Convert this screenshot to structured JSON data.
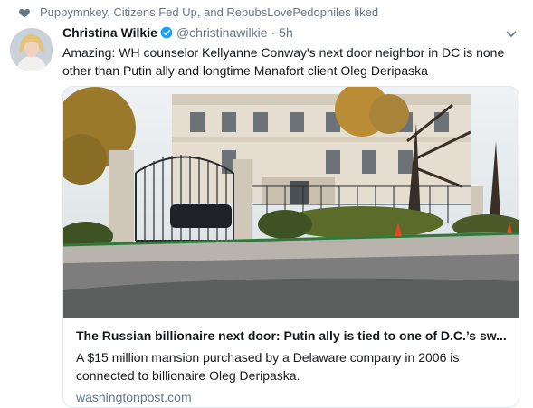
{
  "social_context": {
    "icon": "heart-icon",
    "text": "Puppymnkey, Citizens Fed Up, and RepubsLovePedophiles liked"
  },
  "tweet": {
    "author_name": "Christina Wilkie",
    "author_handle": "@christinawilkie",
    "separator": "·",
    "time": "5h",
    "verified": true,
    "text": "Amazing: WH counselor Kellyanne Conway's next door neighbor in DC is none other than Putin ally and longtime Manafort client Oleg Deripaska"
  },
  "card": {
    "title": "The Russian billionaire next door: Putin ally is tied to one of D.C.’s sw...",
    "description": "A $15 million mansion purchased by a Delaware company in 2006 is connected to billionaire Oleg Deripaska.",
    "domain": "washingtonpost.com"
  },
  "colors": {
    "secondary_text": "#657786",
    "verified_blue": "#1da1f2",
    "border": "#e1e8ed"
  }
}
